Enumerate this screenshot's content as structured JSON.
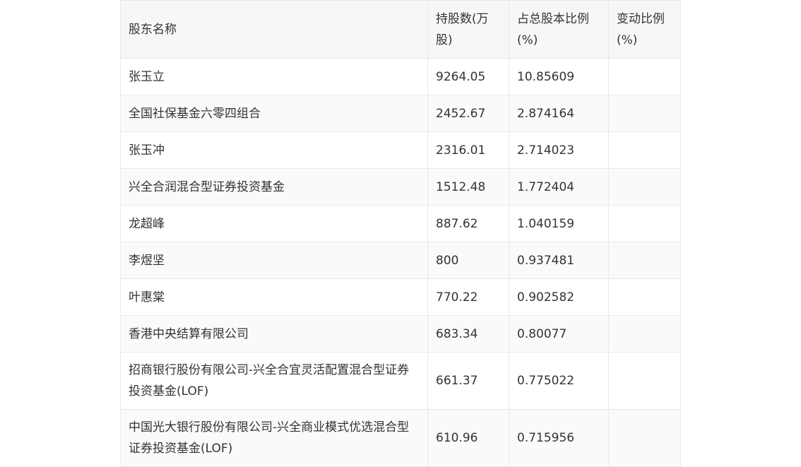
{
  "table": {
    "headers": [
      "股东名称",
      "持股数(万股)",
      "占总股本比例(%)",
      "变动比例(%)"
    ],
    "rows": [
      [
        "张玉立",
        "9264.05",
        "10.85609",
        ""
      ],
      [
        "全国社保基金六零四组合",
        "2452.67",
        "2.874164",
        ""
      ],
      [
        "张玉冲",
        "2316.01",
        "2.714023",
        ""
      ],
      [
        "兴全合润混合型证券投资基金",
        "1512.48",
        "1.772404",
        ""
      ],
      [
        "龙超峰",
        "887.62",
        "1.040159",
        ""
      ],
      [
        "李煜坚",
        "800",
        "0.937481",
        ""
      ],
      [
        "叶惠棠",
        "770.22",
        "0.902582",
        ""
      ],
      [
        "香港中央结算有限公司",
        "683.34",
        "0.80077",
        ""
      ],
      [
        "招商银行股份有限公司-兴全合宜灵活配置混合型证券投资基金(LOF)",
        "661.37",
        "0.775022",
        ""
      ],
      [
        "中国光大银行股份有限公司-兴全商业模式优选混合型证券投资基金(LOF)",
        "610.96",
        "0.715956",
        ""
      ]
    ]
  }
}
